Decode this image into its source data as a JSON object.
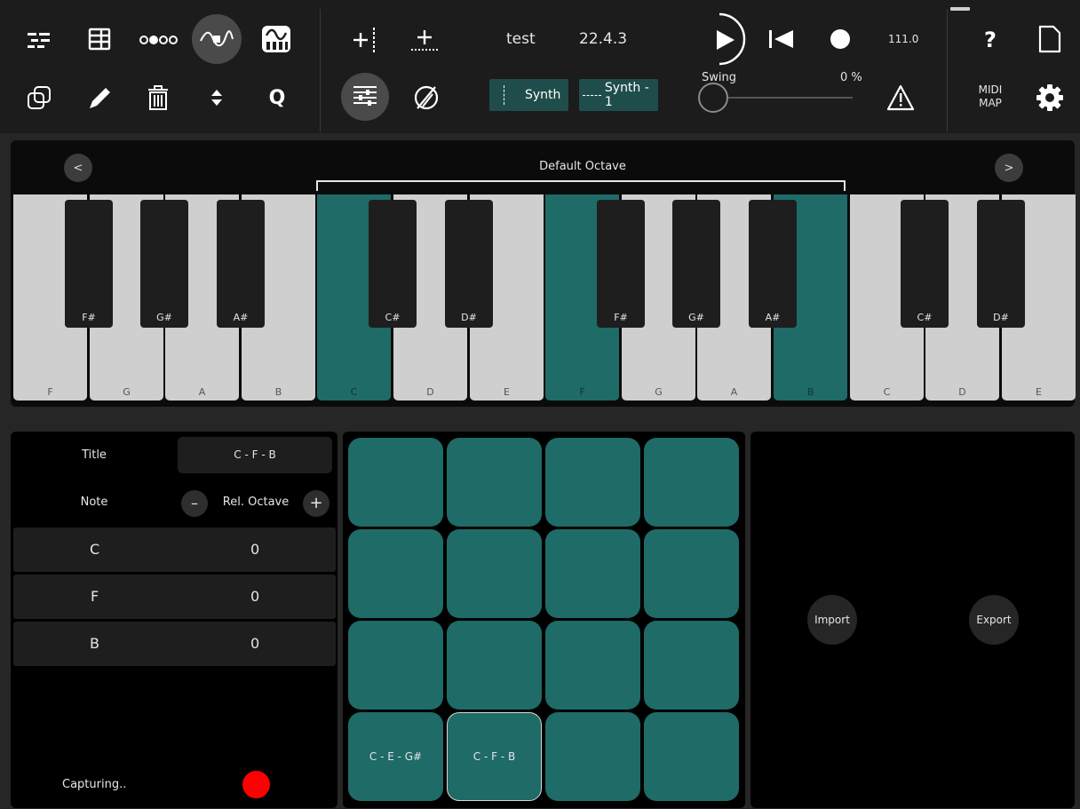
{
  "toolbar": {
    "project_name": "test",
    "position": "22.4.3",
    "bpm": "111.0",
    "swing_label": "Swing",
    "swing_value": "0 %",
    "swing_level": 0,
    "help_label": "?",
    "quantize_label": "Q",
    "midi_map_line1": "MIDI",
    "midi_map_line2": "MAP",
    "track_type": "Synth",
    "track_name": "Synth - 1"
  },
  "keyboard": {
    "octave_label": "Default Octave",
    "prev_label": "<",
    "next_label": ">",
    "white_keys": [
      {
        "note": "F",
        "active": false
      },
      {
        "note": "G",
        "active": false
      },
      {
        "note": "A",
        "active": false
      },
      {
        "note": "B",
        "active": false
      },
      {
        "note": "C",
        "active": true
      },
      {
        "note": "D",
        "active": false
      },
      {
        "note": "E",
        "active": false
      },
      {
        "note": "F",
        "active": true
      },
      {
        "note": "G",
        "active": false
      },
      {
        "note": "A",
        "active": false
      },
      {
        "note": "B",
        "active": true
      },
      {
        "note": "C",
        "active": false
      },
      {
        "note": "D",
        "active": false
      },
      {
        "note": "E",
        "active": false
      }
    ],
    "black_keys": [
      "F#",
      "G#",
      "A#",
      "C#",
      "D#",
      "F#",
      "G#",
      "A#",
      "C#",
      "D#"
    ]
  },
  "chord_editor": {
    "title_label": "Title",
    "title_value": "C - F - B",
    "note_label": "Note",
    "rel_octave_label": "Rel. Octave",
    "minus_label": "–",
    "plus_label": "+",
    "notes": [
      {
        "note": "C",
        "octave": "0"
      },
      {
        "note": "F",
        "octave": "0"
      },
      {
        "note": "B",
        "octave": "0"
      }
    ],
    "status": "Capturing.."
  },
  "pads": {
    "labels": [
      "",
      "",
      "",
      "",
      "",
      "",
      "",
      "",
      "",
      "",
      "",
      "",
      "C - E - G#",
      "C - F - B",
      "",
      ""
    ],
    "selected_index": 13
  },
  "io": {
    "import_label": "Import",
    "export_label": "Export"
  },
  "colors": {
    "accent": "#1e6b68",
    "record": "#ff0000"
  }
}
